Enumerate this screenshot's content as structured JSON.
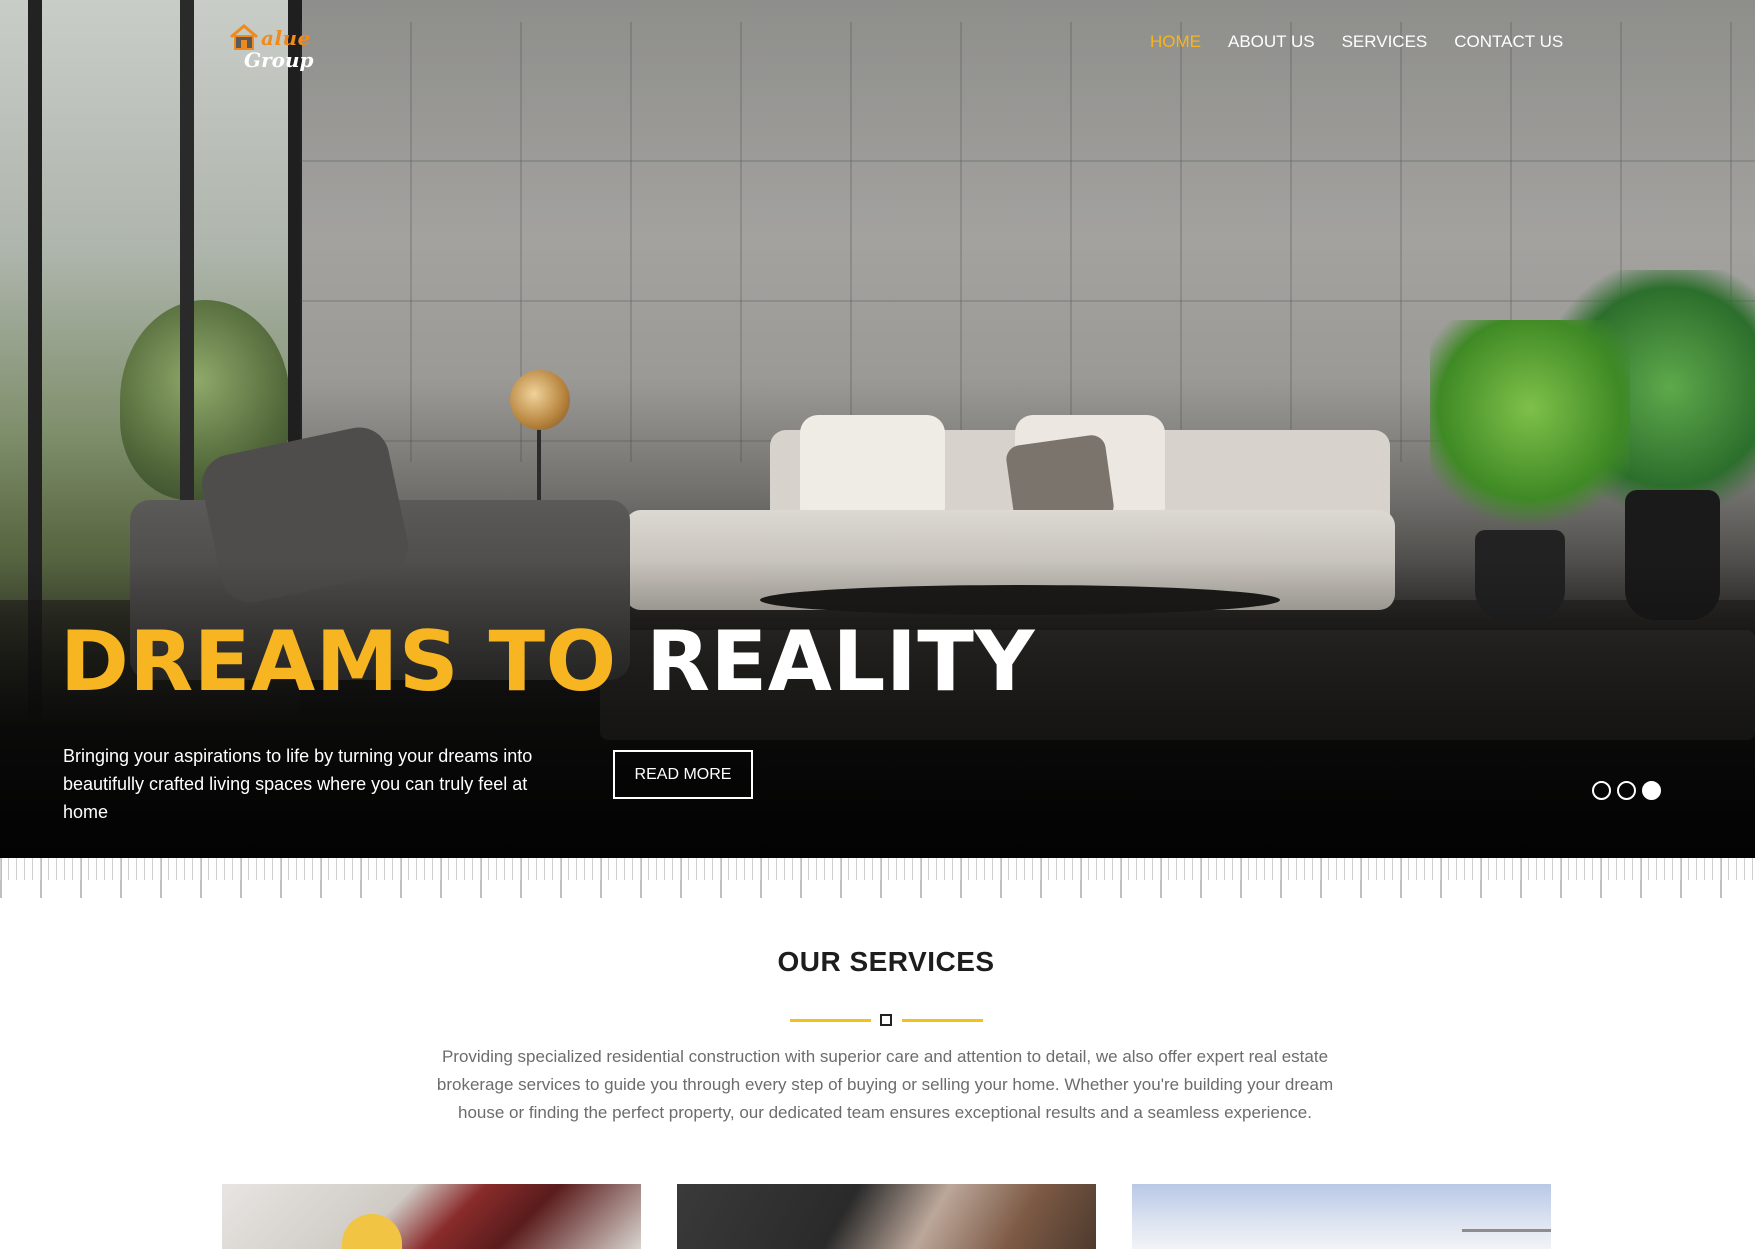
{
  "brand": {
    "logo_line1": "alue",
    "logo_line2": "Group",
    "accent_color": "#f7b521",
    "logo_color": "#f08a1c"
  },
  "nav": {
    "items": [
      {
        "label": "HOME",
        "active": true
      },
      {
        "label": "ABOUT US",
        "active": false
      },
      {
        "label": "SERVICES",
        "active": false
      },
      {
        "label": "CONTACT US",
        "active": false
      }
    ]
  },
  "hero": {
    "headline_part1": "DREAMS TO",
    "headline_part2": "REALITY",
    "subtext": "Bringing your aspirations to life by turning your dreams into beautifully crafted living spaces where you can truly feel at home",
    "button_label": "READ MORE",
    "slides": [
      {
        "active": false
      },
      {
        "active": false
      },
      {
        "active": true
      }
    ]
  },
  "services": {
    "title": "OUR SERVICES",
    "description": "Providing specialized residential construction with superior care and attention to detail, we also offer expert real estate brokerage services to guide you through every step of buying or selling your home. Whether you're building your dream house or finding the perfect property, our dedicated team ensures exceptional results and a seamless experience."
  }
}
